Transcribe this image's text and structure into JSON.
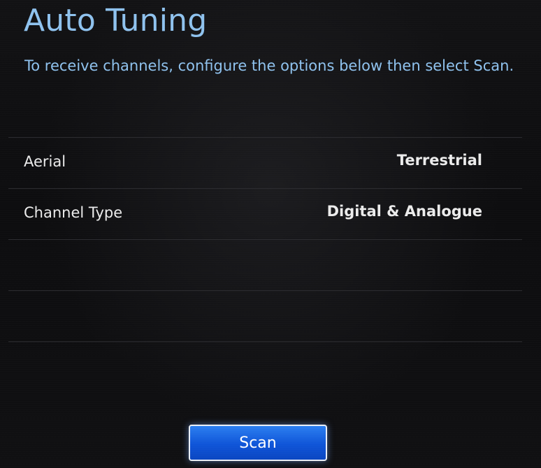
{
  "header": {
    "title": "Auto Tuning",
    "description": "To receive channels, configure the options below then select Scan."
  },
  "options": [
    {
      "label": "Aerial",
      "value": "Terrestrial"
    },
    {
      "label": "Channel Type",
      "value": "Digital & Analogue"
    }
  ],
  "actions": {
    "scan_label": "Scan"
  },
  "colors": {
    "title": "#8fc2ee",
    "button_blue": "#0f55d8",
    "background": "#0b0b0c"
  }
}
